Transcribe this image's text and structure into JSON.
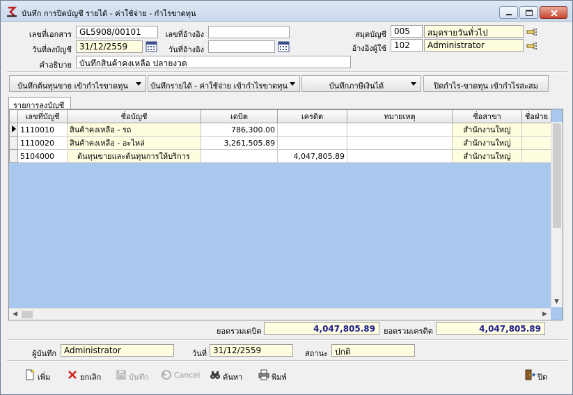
{
  "window": {
    "title": "บันทึก การปิดบัญชี รายได้ - ค่าใช้จ่าย - กำไรขาดทุน"
  },
  "header": {
    "doc_no_label": "เลขที่เอกสาร",
    "doc_no_value": "GL5908/00101",
    "ref_no_label": "เลขที่อ้างอิง",
    "ref_no_value": "",
    "book_label": "สมุดบัญชี",
    "book_code": "005",
    "book_name": "สมุดรายวันทั่วไป",
    "post_date_label": "วันที่ลงบัญชี",
    "post_date_value": "31/12/2559",
    "ref_date_label": "วันที่อ้างอิง",
    "ref_date_value": "",
    "ref_user_label": "อ้างอิงผู้ใช้",
    "ref_user_code": "102",
    "ref_user_name": "Administrator",
    "desc_label": "คำอธิบาย",
    "desc_value": "บันทึกสินค้าคงเหลือ ปลายงวด"
  },
  "actions": [
    "บันทึกต้นทุนขาย เข้ากำไรขาดทุน",
    "บันทึกรายได้ - ค่าใช้จ่าย เข้ากำไรขาดทุน",
    "บันทึกภาษีเงินได้",
    "ปิดกำไร-ขาดทุน เข้ากำไรสะสม"
  ],
  "tab_label": "รายการลงบัญชี",
  "grid": {
    "columns": [
      "เลขที่บัญชี",
      "ชื่อบัญชี",
      "เดบิต",
      "เครดิต",
      "หมายเหตุ",
      "ชื่อสาขา",
      "ชื่อฝ่าย"
    ],
    "rows": [
      {
        "account_no": "1110010",
        "account_name": "สินค้าคงเหลือ - รถ",
        "debit": "786,300.00",
        "credit": "",
        "note": "",
        "branch": "สำนักงานใหญ่",
        "dept": ""
      },
      {
        "account_no": "1110020",
        "account_name": "สินค้าคงเหลือ - อะไหล่",
        "debit": "3,261,505.89",
        "credit": "",
        "note": "",
        "branch": "สำนักงานใหญ่",
        "dept": ""
      },
      {
        "account_no": "5104000",
        "account_name": "ต้นทุนขายและต้นทุนการให้บริการ",
        "debit": "",
        "credit": "4,047,805.89",
        "note": "",
        "branch": "สำนักงานใหญ่",
        "dept": ""
      }
    ]
  },
  "totals": {
    "debit_label": "ยอดรวมเดบิต",
    "debit_value": "4,047,805.89",
    "credit_label": "ยอดรวมเครดิต",
    "credit_value": "4,047,805.89"
  },
  "footer": {
    "recorder_label": "ผู้บันทึก",
    "recorder_value": "Administrator",
    "date_label": "วันที่",
    "date_value": "31/12/2559",
    "status_label": "สถานะ",
    "status_value": "ปกติ"
  },
  "toolbar": {
    "add": "เพิ่ม",
    "cancel_doc": "ยกเลิก",
    "save": "บันทึก",
    "cancel": "Cancel",
    "search": "ค้นหา",
    "print": "พิมพ์",
    "close": "ปิด"
  },
  "colors": {
    "grid_background": "#a8c8ee",
    "readonly_field": "#fffde0",
    "total_text": "#1a1a8c"
  }
}
